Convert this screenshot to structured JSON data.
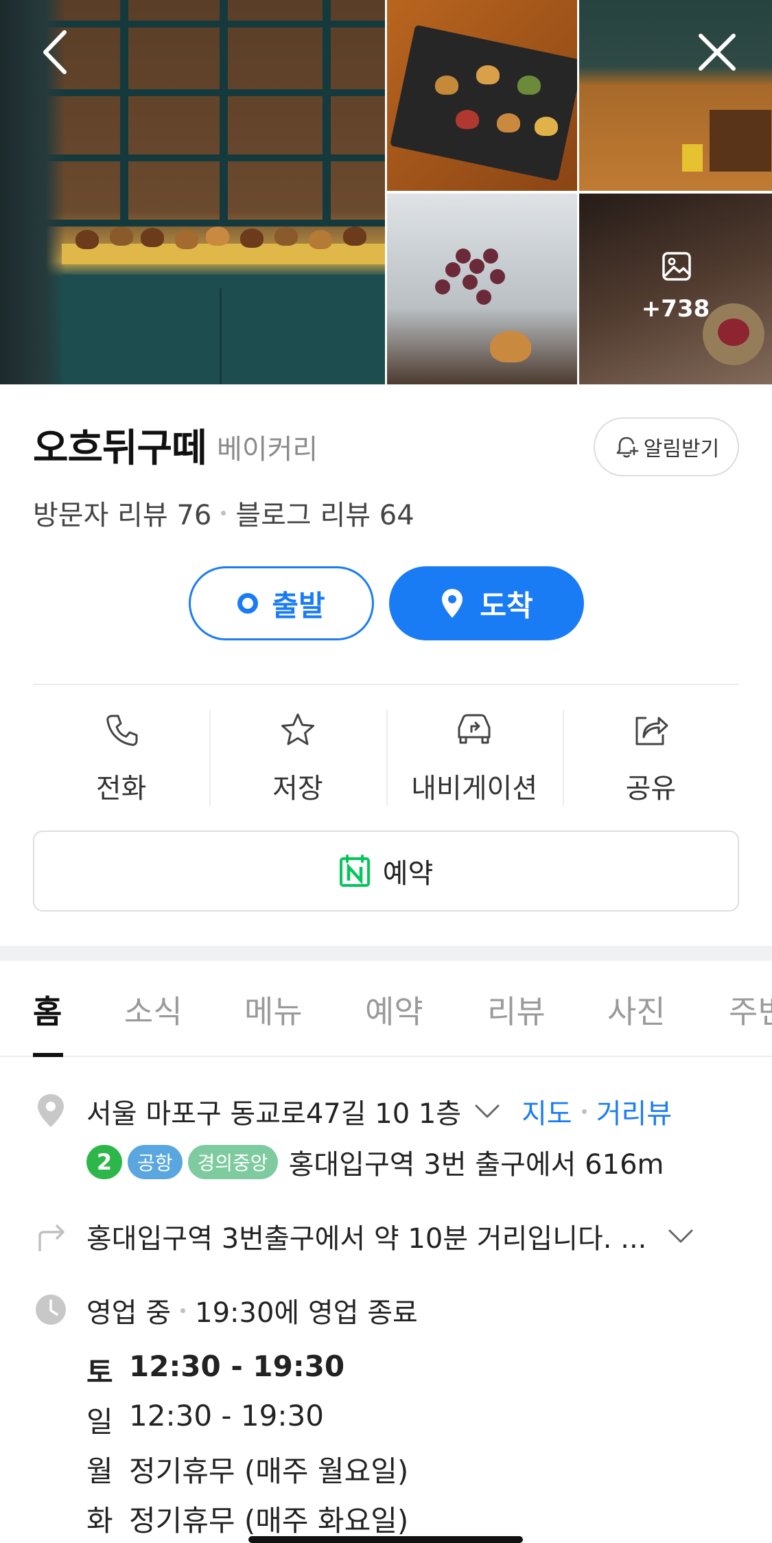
{
  "gallery": {
    "more_count": "+738"
  },
  "place": {
    "name": "오흐뒤구떼",
    "category": "베이커리",
    "notify_label": "알림받기",
    "visitor_reviews": "방문자 리뷰 76",
    "blog_reviews": "블로그 리뷰 64"
  },
  "route": {
    "start_label": "출발",
    "end_label": "도착"
  },
  "actions": [
    {
      "label": "전화",
      "icon": "phone-icon"
    },
    {
      "label": "저장",
      "icon": "star-icon"
    },
    {
      "label": "내비게이션",
      "icon": "navigation-car-icon"
    },
    {
      "label": "공유",
      "icon": "share-icon"
    }
  ],
  "reserve": {
    "label": "예약",
    "icon": "naver-calendar-icon"
  },
  "tabs": [
    "홈",
    "소식",
    "메뉴",
    "예약",
    "리뷰",
    "사진",
    "주변"
  ],
  "info": {
    "address": "서울 마포구 동교로47길 10 1층",
    "map_link": "지도",
    "street_view_link": "거리뷰",
    "transit": {
      "line_number": "2",
      "airport_badge": "공항",
      "gyeongui_badge": "경의중앙",
      "text": "홍대입구역 3번 출구에서 616m"
    },
    "directions": "홍대입구역 3번출구에서 약 10분 거리입니다. ...",
    "status": "영업 중",
    "close_time": "19:30에 영업 종료",
    "hours": [
      {
        "day": "토",
        "time": "12:30 - 19:30"
      },
      {
        "day": "일",
        "time": "12:30 - 19:30"
      },
      {
        "day": "월",
        "time": "정기휴무 (매주 월요일)"
      },
      {
        "day": "화",
        "time": "정기휴무 (매주 화요일)"
      }
    ]
  },
  "colors": {
    "accent": "#1a7cf5",
    "line2": "#2db74a",
    "airport": "#5aa7e0",
    "gyeongui": "#7fcba0",
    "naver_green": "#03c75a"
  }
}
